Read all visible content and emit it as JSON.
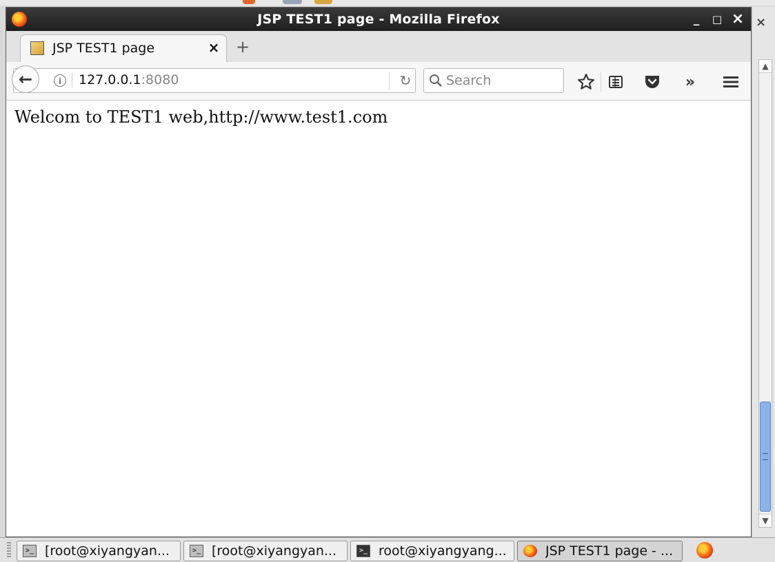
{
  "window": {
    "title": "JSP TEST1 page - Mozilla Firefox",
    "minimize": "_",
    "maximize": "□",
    "close": "×"
  },
  "tabs": [
    {
      "label": "JSP TEST1 page",
      "close": "×"
    }
  ],
  "newtab": "+",
  "navbar": {
    "back": "←",
    "info": "i",
    "url_host": "127.0.0.1",
    "url_port": ":8080",
    "reload": "↻",
    "search_placeholder": "Search",
    "overflow": "»"
  },
  "page": {
    "text": "Welcom to TEST1 web,http://www.test1.com"
  },
  "side": {
    "close": "×"
  },
  "scrollbar": {
    "up": "▲",
    "down": "▼"
  },
  "taskbar": {
    "items": [
      {
        "label": "[root@xiyangyan...",
        "icon": "terminal-icon"
      },
      {
        "label": "[root@xiyangyan...",
        "icon": "terminal-icon"
      },
      {
        "label": "root@xiyangyang...",
        "icon": "terminal-icon"
      },
      {
        "label": "JSP TEST1 page - ...",
        "icon": "firefox-icon"
      }
    ]
  },
  "colors": {
    "titlebar": "#2b2b2b",
    "scroll_thumb": "#8fb2e6"
  }
}
